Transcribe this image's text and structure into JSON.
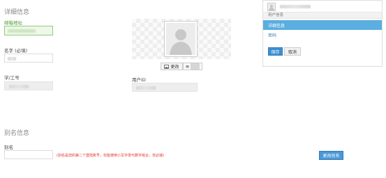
{
  "profile": {
    "section_title": "详细信息",
    "email_label": "邮箱地址",
    "name_label": "名字 (必填)",
    "student_id_label": "学/工号",
    "user_id_label": "用户ID",
    "change_button": "更改",
    "delete_button": "删除"
  },
  "sidebar": {
    "header": "用户信息",
    "items": [
      {
        "label": "详细信息",
        "active": true
      },
      {
        "label": "密码",
        "active": false
      }
    ],
    "save_button": "保存",
    "cancel_button": "取消"
  },
  "alias": {
    "section_title": "别名信息",
    "alias_label": "别名",
    "hint": "(别名是您的第二个登陆账号，仅能使用小写字母与数字组合，非必填)",
    "update_button": "更改别名"
  },
  "colors": {
    "accent": "#5aaee0",
    "primary_button": "#3e8fd0",
    "hint_red": "#e0302a",
    "valid_green": "#4a9a2a"
  }
}
